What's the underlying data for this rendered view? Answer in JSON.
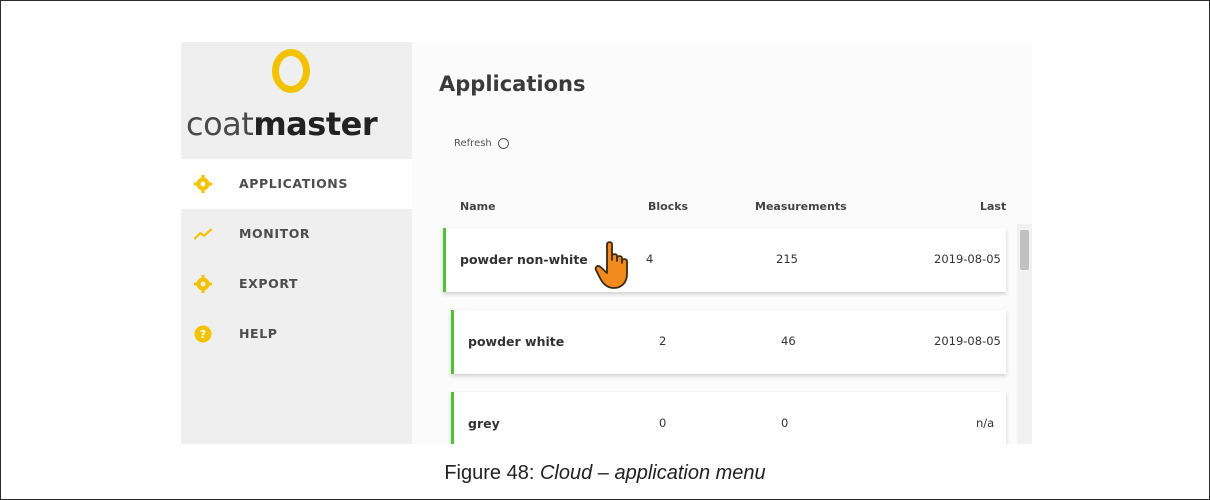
{
  "sidebar": {
    "logo": {
      "prefix": "coat",
      "suffix": "master",
      "accent_color": "#f4c300"
    },
    "items": [
      {
        "label": "APPLICATIONS",
        "icon": "gear-icon",
        "active": true
      },
      {
        "label": "MONITOR",
        "icon": "trend-line-icon",
        "active": false
      },
      {
        "label": "EXPORT",
        "icon": "gear-icon",
        "active": false
      },
      {
        "label": "HELP",
        "icon": "help-circle-icon",
        "active": false
      }
    ]
  },
  "main": {
    "title": "Applications",
    "refresh_label": "Refresh",
    "columns": [
      "Name",
      "Blocks",
      "Measurements",
      "Last"
    ],
    "rows": [
      {
        "name": "powder non-white",
        "blocks": "4",
        "measurements": "215",
        "last": "2019-08-05"
      },
      {
        "name": "powder white",
        "blocks": "2",
        "measurements": "46",
        "last": "2019-08-05"
      },
      {
        "name": "grey",
        "blocks": "0",
        "measurements": "0",
        "last": "n/a"
      }
    ],
    "row_accent_color": "#52c234"
  },
  "caption": {
    "prefix": "Figure 48: ",
    "emphasis": "Cloud – application menu"
  }
}
